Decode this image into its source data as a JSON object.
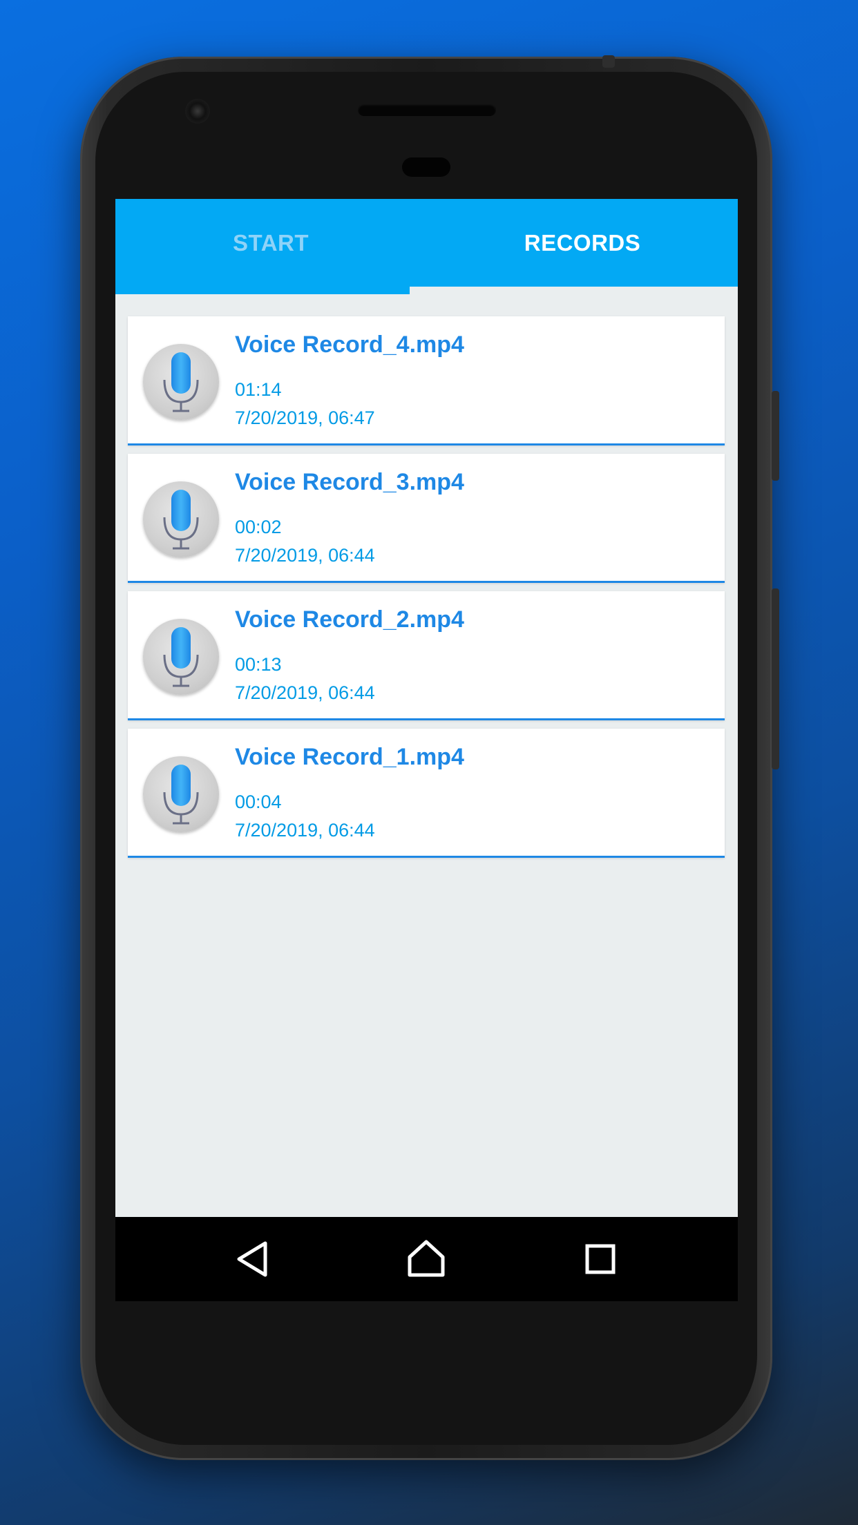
{
  "tabs": {
    "start_label": "START",
    "records_label": "RECORDS"
  },
  "records": [
    {
      "title": "Voice Record_4.mp4",
      "duration": "01:14",
      "date": "7/20/2019, 06:47"
    },
    {
      "title": "Voice Record_3.mp4",
      "duration": "00:02",
      "date": "7/20/2019, 06:44"
    },
    {
      "title": "Voice Record_2.mp4",
      "duration": "00:13",
      "date": "7/20/2019, 06:44"
    },
    {
      "title": "Voice Record_1.mp4",
      "duration": "00:04",
      "date": "7/20/2019, 06:44"
    }
  ],
  "icons": {
    "record": "microphone-icon",
    "nav_back": "back-icon",
    "nav_home": "home-icon",
    "nav_recents": "recents-icon"
  },
  "colors": {
    "accent": "#03a9f4",
    "title": "#1e88e5",
    "meta": "#039be5",
    "background": "#eaeeef"
  }
}
